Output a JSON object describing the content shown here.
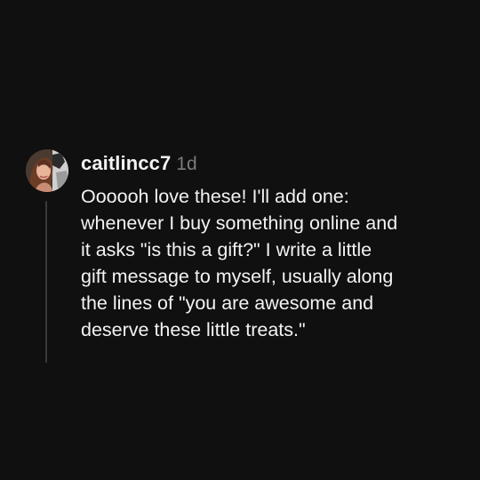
{
  "comment": {
    "username": "caitlincc7",
    "timestamp": "1d",
    "avatar_icon": "user-avatar-photo",
    "lines": [
      "Oooooh love these! I'll add one:",
      "whenever I buy something online and",
      "it asks \"is this a gift?\" I write a little",
      "gift message to myself, usually along",
      "the lines of \"you are awesome and",
      "deserve these little treats.\""
    ]
  },
  "colors": {
    "background": "#101010",
    "text": "#f3f3f3",
    "muted": "#7b7b7b",
    "thread_line": "#3a3a3a"
  }
}
